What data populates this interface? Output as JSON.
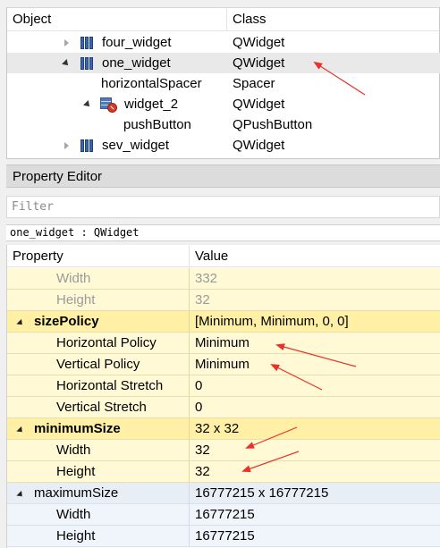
{
  "object_inspector": {
    "headers": {
      "object": "Object",
      "class": "Class"
    },
    "rows": [
      {
        "name": "four_widget",
        "class": "QWidget"
      },
      {
        "name": "one_widget",
        "class": "QWidget"
      },
      {
        "name": "horizontalSpacer",
        "class": "Spacer"
      },
      {
        "name": "widget_2",
        "class": "QWidget"
      },
      {
        "name": "pushButton",
        "class": "QPushButton"
      },
      {
        "name": "sev_widget",
        "class": "QWidget"
      }
    ]
  },
  "property_editor": {
    "title": "Property Editor",
    "filter_placeholder": "Filter",
    "object_class_line": "one_widget : QWidget",
    "headers": {
      "property": "Property",
      "value": "Value"
    },
    "rows": [
      {
        "name": "Width",
        "value": "332"
      },
      {
        "name": "Height",
        "value": "32"
      },
      {
        "name": "sizePolicy",
        "value": "[Minimum, Minimum, 0, 0]"
      },
      {
        "name": "Horizontal Policy",
        "value": "Minimum"
      },
      {
        "name": "Vertical Policy",
        "value": "Minimum"
      },
      {
        "name": "Horizontal Stretch",
        "value": "0"
      },
      {
        "name": "Vertical Stretch",
        "value": "0"
      },
      {
        "name": "minimumSize",
        "value": "32 x 32"
      },
      {
        "name": "Width",
        "value": "32"
      },
      {
        "name": "Height",
        "value": "32"
      },
      {
        "name": "maximumSize",
        "value": "16777215 x 16777215"
      },
      {
        "name": "Width",
        "value": "16777215"
      },
      {
        "name": "Height",
        "value": "16777215"
      }
    ]
  },
  "colors": {
    "annotation_red": "#e8322b",
    "section_yellow": "#fff0a6",
    "row_yellow": "#fffad5",
    "section_blue": "#e8eef6"
  }
}
